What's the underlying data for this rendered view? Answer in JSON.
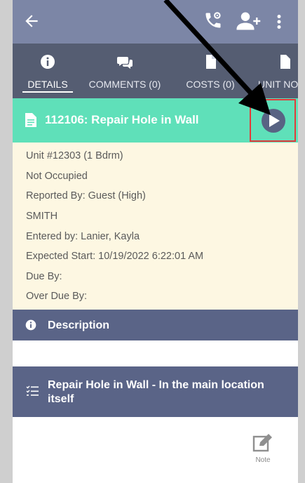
{
  "top_caption": "...",
  "tabs": [
    {
      "label": "DETAILS",
      "icon": "info-icon",
      "active": true
    },
    {
      "label": "COMMENTS (0)",
      "icon": "comments-icon",
      "active": false
    },
    {
      "label": "COSTS (0)",
      "icon": "document-icon",
      "active": false
    },
    {
      "label": "UNIT NO",
      "icon": "document-icon",
      "active": false
    }
  ],
  "work_order": {
    "title": "112106: Repair Hole in Wall"
  },
  "details": {
    "unit": "Unit #12303 (1 Bdrm)",
    "occupancy": "Not Occupied",
    "reported_by": "Reported By: Guest  (High)",
    "name": "SMITH",
    "entered_by": "Entered by: Lanier, Kayla",
    "expected_start": "Expected Start: 10/19/2022 6:22:01 AM",
    "due_by": "Due By:",
    "over_due_by": "Over Due By:"
  },
  "description": {
    "label": "Description"
  },
  "task": {
    "label": "Repair Hole in Wall - In the main location itself"
  },
  "note": {
    "label": "Note"
  },
  "colors": {
    "appbar": "#7c86a6",
    "tabs": "#555d72",
    "header_accent": "#5fe0b9",
    "details_bg": "#fdf7e2",
    "section_bar": "#5a6487",
    "highlight": "#e23a3a"
  }
}
